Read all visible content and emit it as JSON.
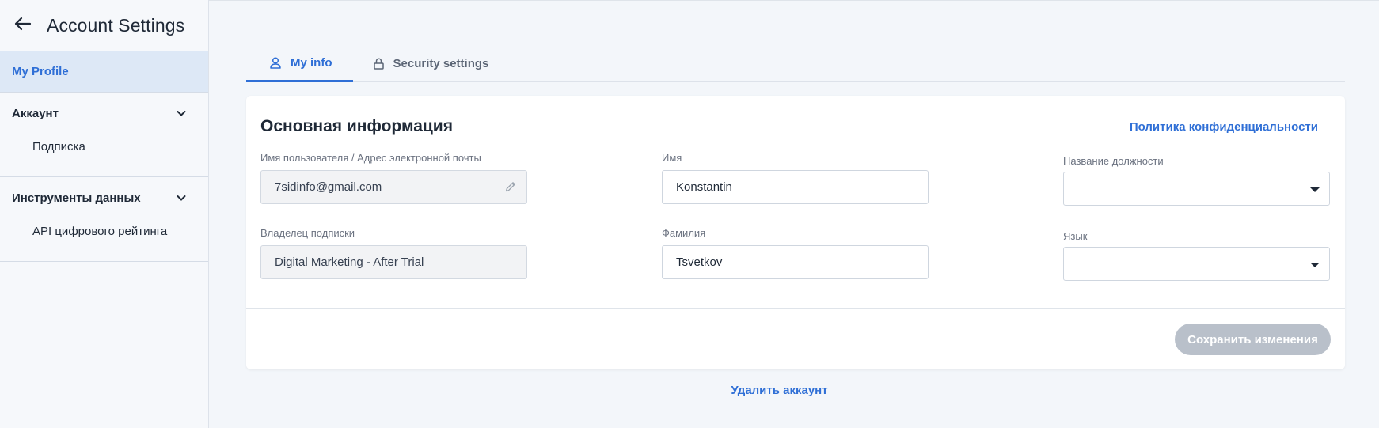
{
  "sidebar": {
    "title": "Account Settings",
    "back_icon": "arrow-left-icon",
    "active_item": "My Profile",
    "groups": [
      {
        "label": "Аккаунт",
        "items": [
          {
            "label": "Подписка"
          }
        ]
      },
      {
        "label": "Инструменты данных",
        "items": [
          {
            "label": "API цифрового рейтинга"
          }
        ]
      }
    ]
  },
  "tabs": [
    {
      "label": "My info",
      "icon": "user-icon",
      "active": true
    },
    {
      "label": "Security settings",
      "icon": "lock-icon",
      "active": false
    }
  ],
  "card": {
    "title": "Основная информация",
    "privacy_link": "Политика конфиденциальности",
    "fields": {
      "username": {
        "label": "Имя пользователя / Адрес электронной почты",
        "value": "7sidinfo@gmail.com"
      },
      "owner": {
        "label": "Владелец подписки",
        "value": "Digital Marketing - After Trial"
      },
      "first_name": {
        "label": "Имя",
        "value": "Konstantin"
      },
      "last_name": {
        "label": "Фамилия",
        "value": "Tsvetkov"
      },
      "job_title": {
        "label": "Название должности",
        "value": ""
      },
      "language": {
        "label": "Язык",
        "value": ""
      }
    },
    "save_label": "Сохранить изменения"
  },
  "delete_account": "Удалить аккаунт",
  "colors": {
    "accent": "#2f6fd6",
    "active_bg": "#dde8f6",
    "disabled_button": "#b9c0ca"
  }
}
